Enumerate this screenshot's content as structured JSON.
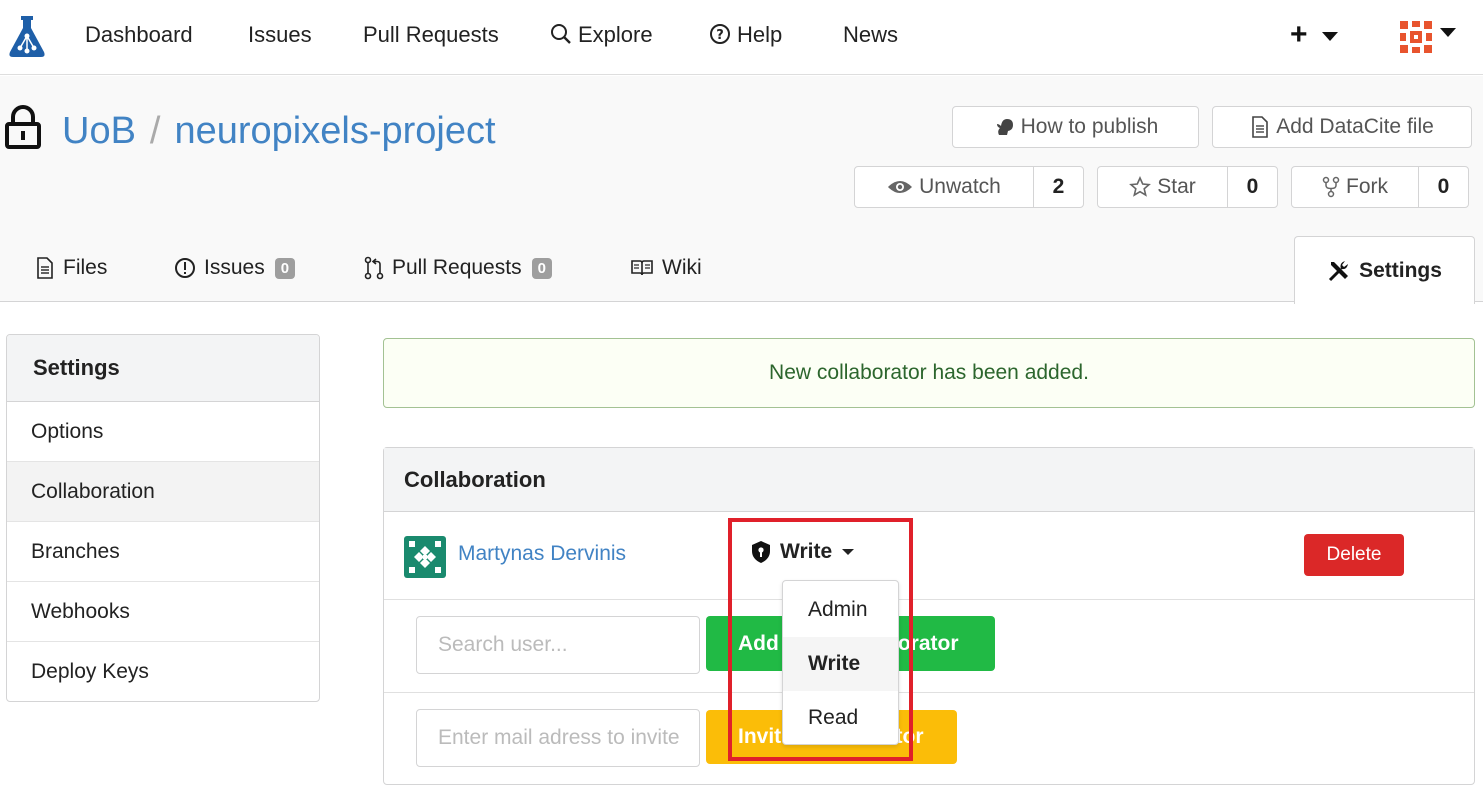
{
  "nav": {
    "items": [
      "Dashboard",
      "Issues",
      "Pull Requests",
      "Explore",
      "Help",
      "News"
    ],
    "plus": "+",
    "icons": {
      "logo": "gin-logo-icon",
      "explore": "search-icon",
      "help": "question-circle-icon",
      "avatar": "user-avatar-icon"
    }
  },
  "repo": {
    "owner": "UoB",
    "separator": "/",
    "name": "neuropixels-project",
    "lock_icon": "lock-icon",
    "how_to_publish": "How to publish",
    "add_datacite": "Add DataCite file",
    "unwatch": "Unwatch",
    "watch_count": "2",
    "star": "Star",
    "star_count": "0",
    "fork": "Fork",
    "fork_count": "0"
  },
  "tabs": {
    "files": "Files",
    "issues": "Issues",
    "issues_count": "0",
    "pulls": "Pull Requests",
    "pulls_count": "0",
    "wiki": "Wiki",
    "settings": "Settings"
  },
  "sidebar": {
    "title": "Settings",
    "items": [
      "Options",
      "Collaboration",
      "Branches",
      "Webhooks",
      "Deploy Keys"
    ],
    "active": "Collaboration"
  },
  "message": "New collaborator has been added.",
  "collaboration": {
    "title": "Collaboration",
    "collaborator": {
      "name": "Martynas Dervinis",
      "permission": "Write",
      "delete": "Delete"
    },
    "search_placeholder": "Search user...",
    "add_button": "Add New Collaborator",
    "mail_placeholder": "Enter mail adress to invite",
    "invite_button": "Invite Collaborator"
  },
  "permission_dropdown": {
    "options": [
      "Admin",
      "Write",
      "Read"
    ],
    "selected": "Write"
  },
  "colors": {
    "link": "#4183c4",
    "success_bg": "#fcfff5",
    "success_text": "#2c662d",
    "delete": "#db2828",
    "green": "#21ba45",
    "yellow": "#fbbd08",
    "highlight": "#e0202a"
  }
}
